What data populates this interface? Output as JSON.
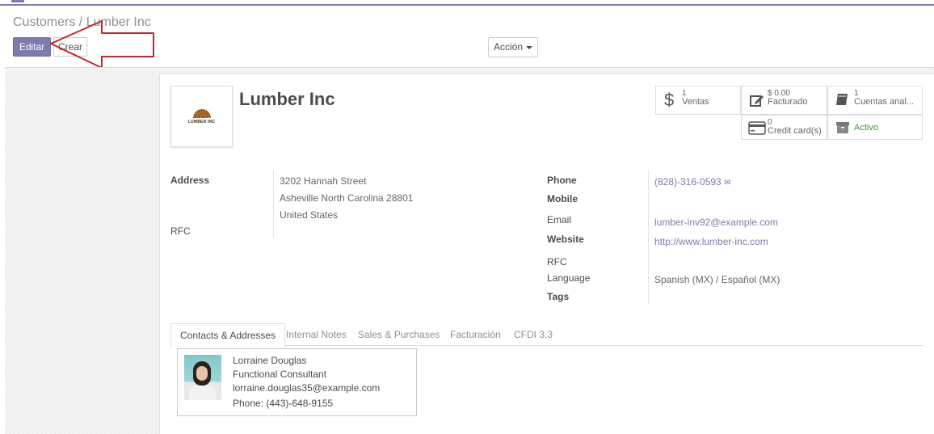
{
  "breadcrumb": {
    "parent": "Customers",
    "separator": " / ",
    "current": "Lumber Inc"
  },
  "toolbar": {
    "edit_label": "Editar",
    "create_label": "Crear",
    "action_label": "Acción"
  },
  "partner": {
    "name": "Lumber Inc",
    "logo_text": "LUMBER INC"
  },
  "stats": {
    "sales": {
      "value": "1",
      "label": "Ventas"
    },
    "invoiced": {
      "value": "$ 0.00",
      "label": "Facturado"
    },
    "analytic": {
      "value": "1",
      "label": "Cuentas anal..."
    },
    "credit_cards": {
      "value": "0",
      "label": "Credit card(s)"
    },
    "active": {
      "label": "Activo"
    }
  },
  "fields_left": {
    "address_label": "Address",
    "address_line1": "3202 Hannah Street",
    "address_line2": "Asheville  North Carolina  28801",
    "address_line3": "United States",
    "rfc_label": "RFC"
  },
  "fields_right": {
    "phone_label": "Phone",
    "phone_value": "(828)-316-0593",
    "mobile_label": "Mobile",
    "email_label": "Email",
    "email_value": "lumber-inv92@example.com",
    "website_label": "Website",
    "website_value": "http://www.lumber-inc.com",
    "rfc_label": "RFC",
    "language_label": "Language",
    "language_value": "Spanish (MX) / Español (MX)",
    "tags_label": "Tags"
  },
  "tabs": [
    "Contacts & Addresses",
    "Internal Notes",
    "Sales & Purchases",
    "Facturación",
    "CFDI 3.3"
  ],
  "contact": {
    "name": "Lorraine Douglas",
    "title": "Functional Consultant",
    "email": "lorraine.douglas35@example.com",
    "phone": "Phone: (443)-648-9155"
  },
  "colors": {
    "primary": "#7c7bad",
    "annotation_arrow": "#c0262d",
    "active_status": "#3c9a3c"
  }
}
